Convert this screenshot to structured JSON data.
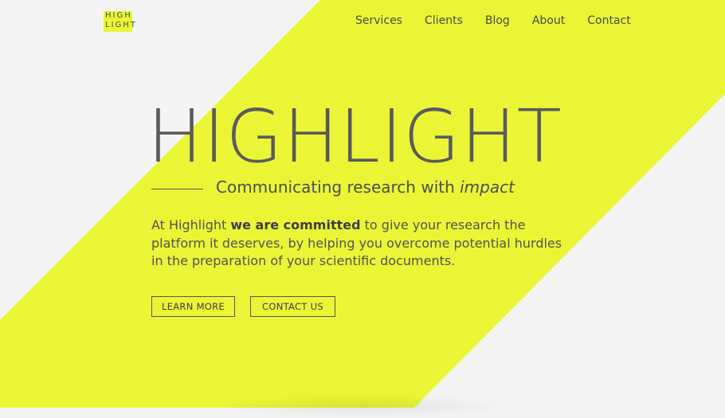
{
  "colors": {
    "accent": "#eaf635",
    "background": "#f4f4f5",
    "text": "#555559"
  },
  "logo": {
    "line1": "HIGH",
    "line2": "LIGHT"
  },
  "nav": {
    "items": [
      "Services",
      "Clients",
      "Blog",
      "About",
      "Contact"
    ]
  },
  "hero": {
    "title": "HIGHLIGHT",
    "tagline_main": "Communicating research with ",
    "tagline_emphasis": "impact",
    "intro_start": "At Highlight ",
    "intro_bold": "we are committed",
    "intro_end": " to give your research the platform it deserves, by helping you overcome potential hurdles in the preparation of your scientific documents."
  },
  "buttons": {
    "learn_more": "LEARN MORE",
    "contact_us": "CONTACT US"
  }
}
